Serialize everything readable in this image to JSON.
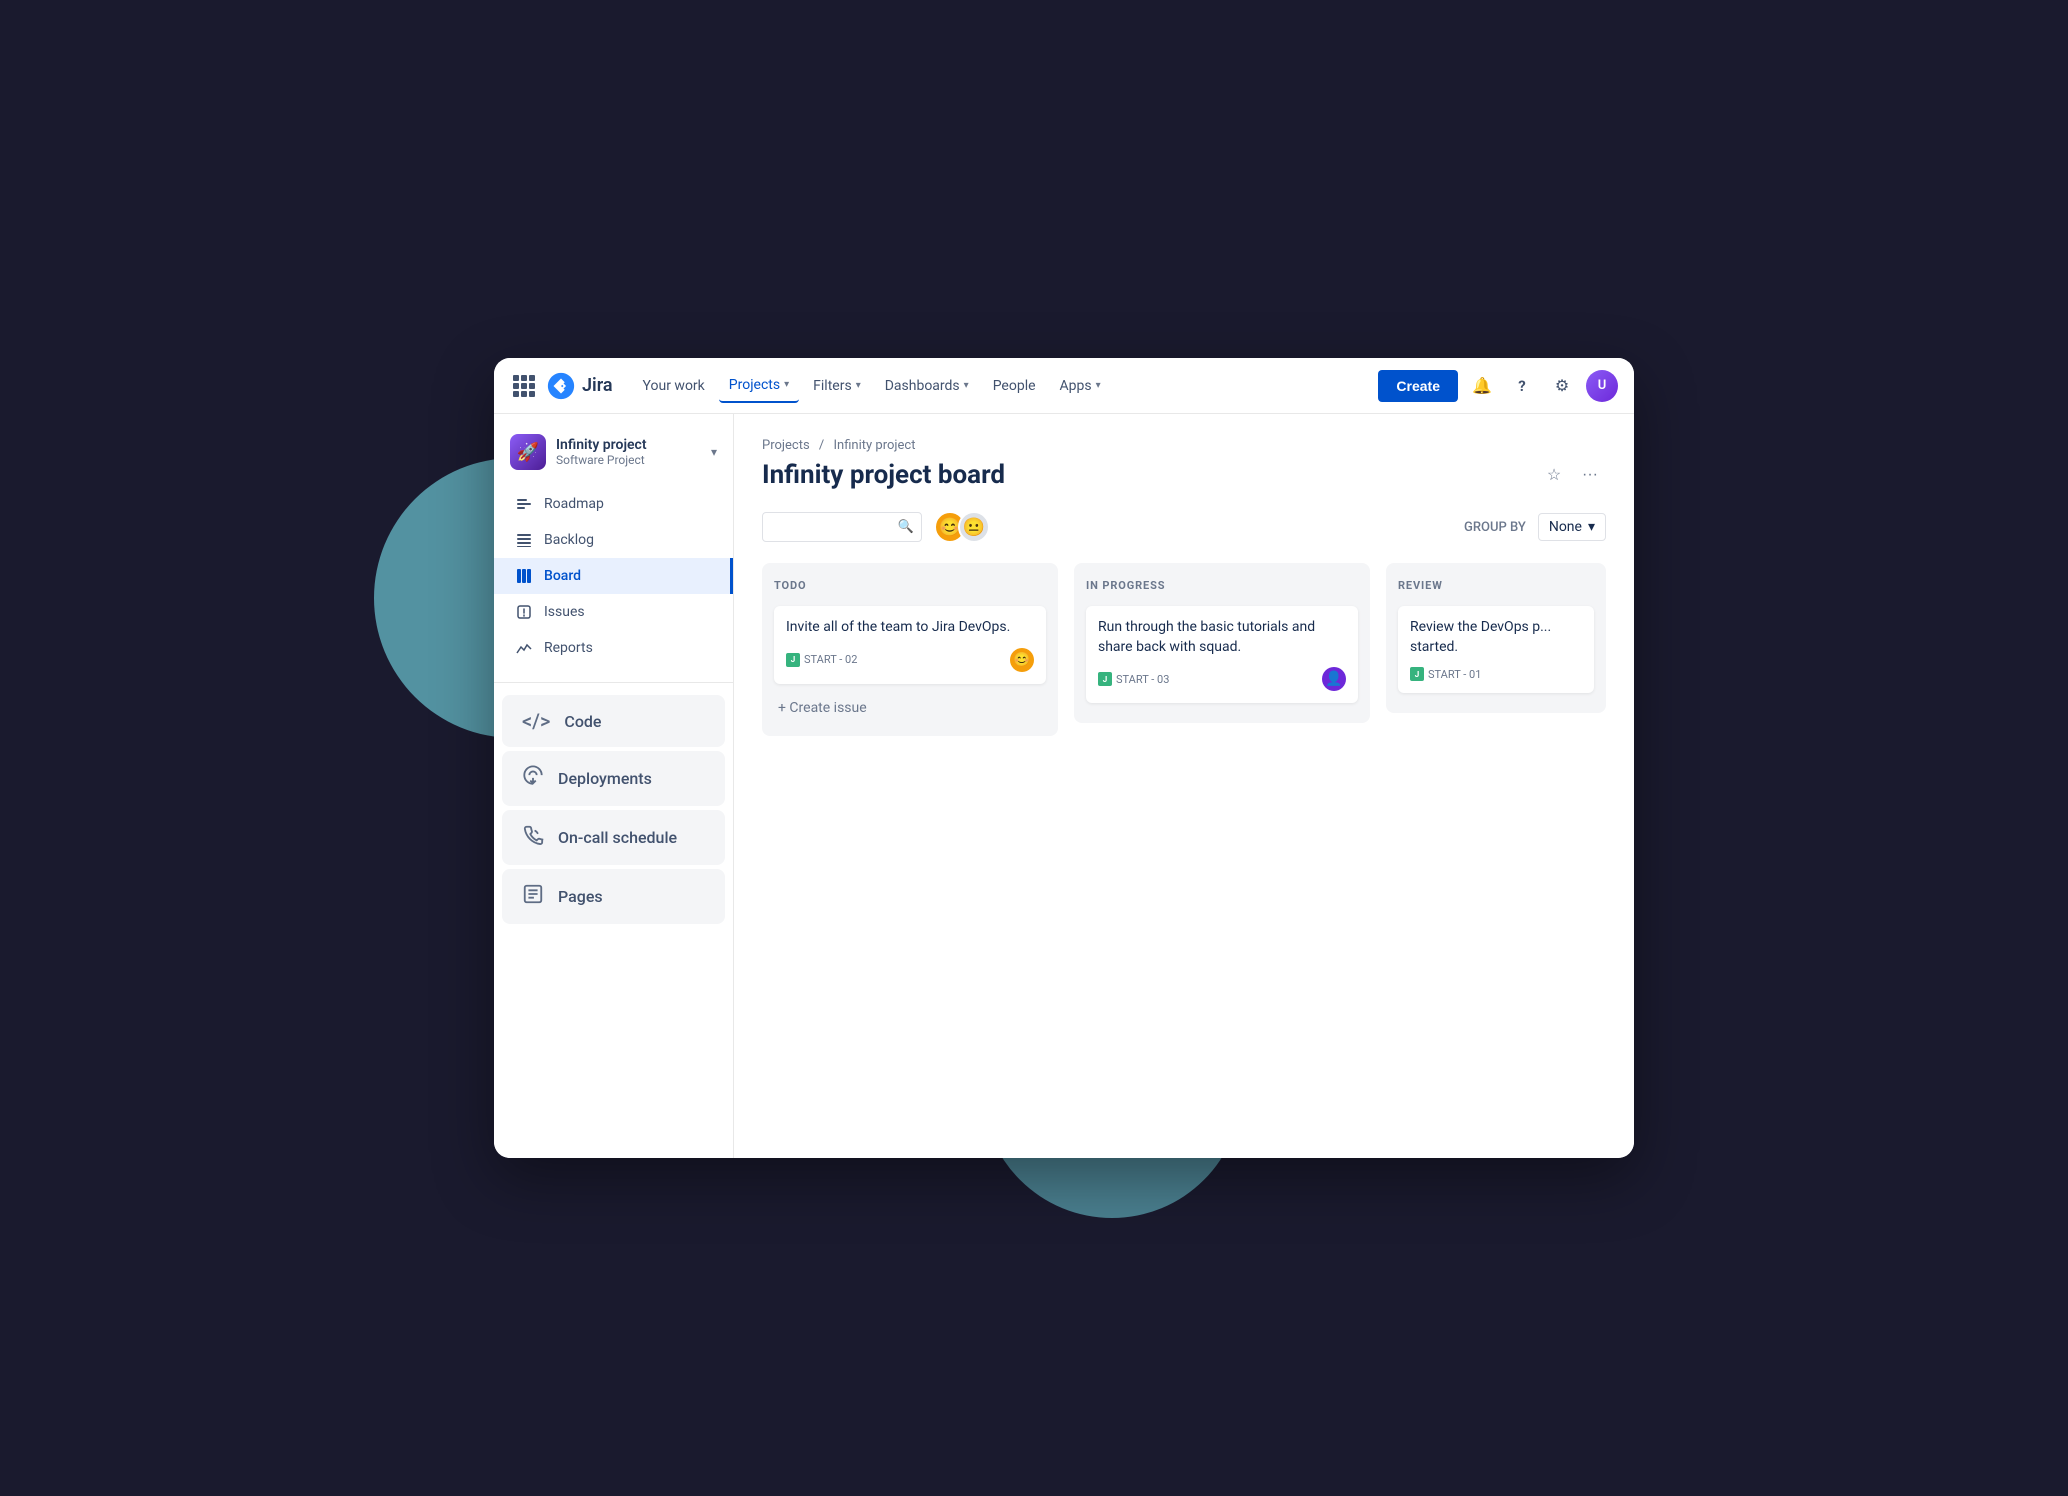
{
  "nav": {
    "your_work": "Your work",
    "projects": "Projects",
    "filters": "Filters",
    "dashboards": "Dashboards",
    "people": "People",
    "apps": "Apps",
    "create": "Create"
  },
  "project": {
    "name": "Infinity project",
    "type": "Software Project",
    "icon_emoji": "🚀"
  },
  "sidebar": {
    "items": [
      {
        "label": "Roadmap",
        "icon": "≡",
        "active": false
      },
      {
        "label": "Backlog",
        "icon": "☰",
        "active": false
      },
      {
        "label": "Board",
        "icon": "⊞",
        "active": true
      },
      {
        "label": "Issues",
        "icon": "⚠",
        "active": false
      },
      {
        "label": "Reports",
        "icon": "📈",
        "active": false
      }
    ],
    "extra_items": [
      {
        "label": "Code",
        "icon": "</>"
      },
      {
        "label": "Deployments",
        "icon": "☁"
      },
      {
        "label": "On-call schedule",
        "icon": "📞"
      },
      {
        "label": "Pages",
        "icon": "📄"
      }
    ]
  },
  "breadcrumb": {
    "projects": "Projects",
    "project": "Infinity project"
  },
  "board": {
    "title": "Infinity project board",
    "group_by_label": "GROUP BY",
    "group_by_value": "None",
    "search_placeholder": "",
    "columns": [
      {
        "id": "todo",
        "header": "TODO",
        "issues": [
          {
            "text": "Invite all of the team to Jira DevOps.",
            "tag": "START - 02",
            "avatar_type": "orange"
          }
        ],
        "create_label": "+ Create issue"
      },
      {
        "id": "in-progress",
        "header": "IN PROGRESS",
        "issues": [
          {
            "text": "Run through the basic tutorials and share back with squad.",
            "tag": "START - 03",
            "avatar_type": "purple"
          }
        ],
        "create_label": null
      },
      {
        "id": "review",
        "header": "REVIEW",
        "issues": [
          {
            "text": "Review the DevOps p... started.",
            "tag": "START - 01",
            "avatar_type": null
          }
        ],
        "create_label": null,
        "partial": true
      }
    ]
  },
  "icons": {
    "search": "🔍",
    "star": "☆",
    "more": "•••",
    "bell": "🔔",
    "help": "?",
    "settings": "⚙"
  }
}
